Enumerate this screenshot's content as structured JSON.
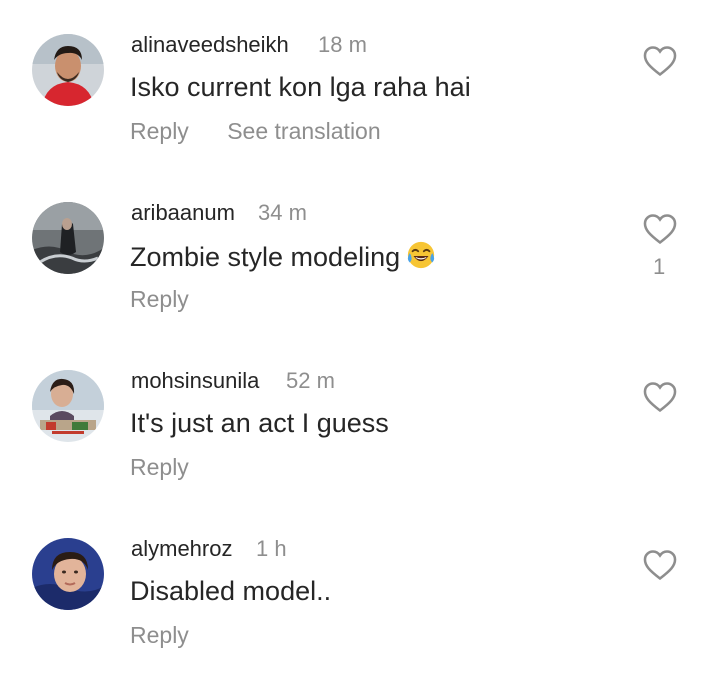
{
  "comments": [
    {
      "username": "alinaveedsheikh",
      "time": "18 m",
      "text": "Isko current kon lga raha hai",
      "reply_label": "Reply",
      "translate_label": "See translation",
      "like_count": ""
    },
    {
      "username": "aribaanum",
      "time": "34 m",
      "text": "Zombie style modeling",
      "emoji": "face-with-tears-of-joy",
      "reply_label": "Reply",
      "like_count": "1"
    },
    {
      "username": "mohsinsunila",
      "time": "52 m",
      "text": "It's just an act I guess",
      "reply_label": "Reply",
      "like_count": ""
    },
    {
      "username": "alymehroz",
      "time": "1 h",
      "text": "Disabled model..",
      "reply_label": "Reply",
      "like_count": ""
    }
  ],
  "icons": {
    "like": "heart-outline-icon"
  },
  "colors": {
    "primary_text": "#262626",
    "secondary_text": "#8e8e8e",
    "background": "#ffffff"
  }
}
